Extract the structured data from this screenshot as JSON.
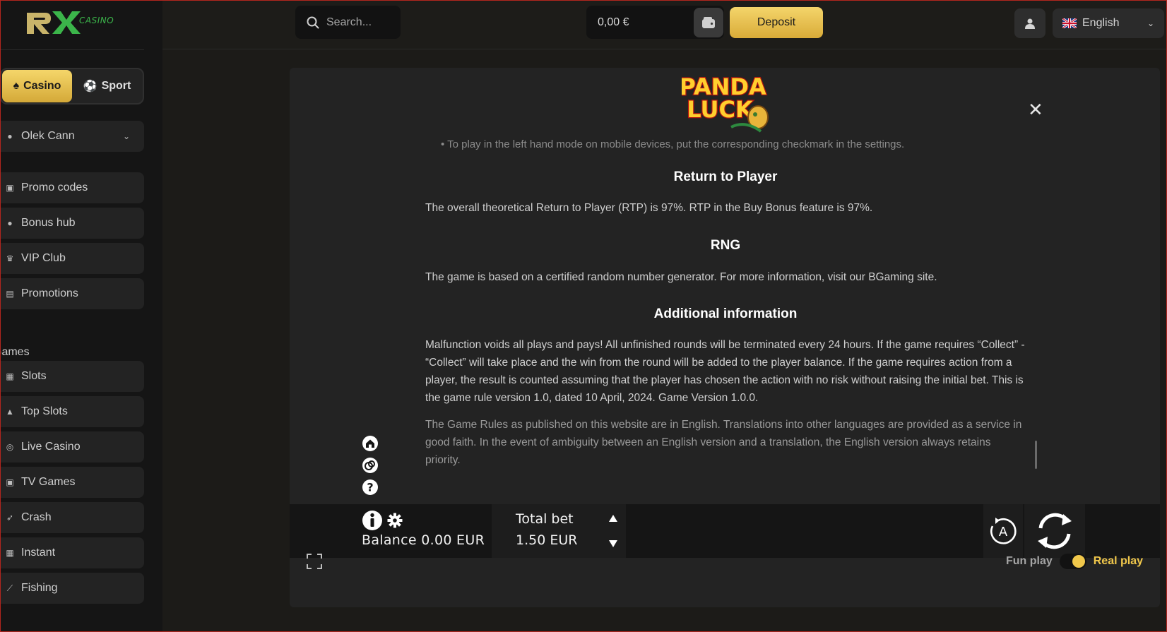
{
  "brand": {
    "logo_text": "RX",
    "logo_sub": "CASINO"
  },
  "sidebar": {
    "mode": {
      "casino_label": "Casino",
      "sport_label": "Sport",
      "active": "casino"
    },
    "user": {
      "name": "Olek Cann"
    },
    "items": [
      {
        "label": "Promo codes",
        "icon": "gift-icon"
      },
      {
        "label": "Bonus hub",
        "icon": "coin-icon"
      },
      {
        "label": "VIP Club",
        "icon": "crown-icon"
      },
      {
        "label": "Promotions",
        "icon": "percent-icon"
      }
    ],
    "games_heading": "Games",
    "games": [
      {
        "label": "Slots",
        "icon": "slot-machine-icon"
      },
      {
        "label": "Top Slots",
        "icon": "top-slots-icon"
      },
      {
        "label": "Live Casino",
        "icon": "chip-icon"
      },
      {
        "label": "TV Games",
        "icon": "tv-icon"
      },
      {
        "label": "Crash",
        "icon": "rocket-icon"
      },
      {
        "label": "Instant",
        "icon": "grid-icon"
      },
      {
        "label": "Fishing",
        "icon": "fishing-rod-icon"
      }
    ]
  },
  "header": {
    "search_placeholder": "Search...",
    "balance": "0,00 €",
    "deposit_label": "Deposit",
    "language": "English"
  },
  "game": {
    "logo_line1": "PANDA",
    "logo_line2": "LUCK",
    "rules": {
      "bullet": "To play in the left hand mode on mobile devices, put the corresponding checkmark in the settings.",
      "rtp_title": "Return to Player",
      "rtp_text": "The overall theoretical Return to Player (RTP) is 97%. RTP in the Buy Bonus feature is 97%.",
      "rng_title": "RNG",
      "rng_text": "The game is based on a certified random number generator. For more information, visit our BGaming site.",
      "additional_title": "Additional information",
      "additional_text": "Malfunction voids all plays and pays! All unfinished rounds will be terminated every 24 hours. If the game requires “Collect” - “Collect” will take place and the win from the round will be added to the player balance. If the game requires action from a player, the result is counted assuming that the player has chosen the action with no risk without raising the initial bet. This is the game rule version 1.0, dated 10 April, 2024. Game Version 1.0.0.",
      "language_text": "The Game Rules as published on this website are in English. Translations into other languages are provided as a service in good faith. In the event of ambiguity between an English version and a translation, the English version always retains priority."
    },
    "controls": {
      "balance_label": "Balance 0.00 EUR",
      "total_bet_label": "Total bet",
      "total_bet_value": "1.50 EUR",
      "auto_label": "A"
    },
    "play_mode": {
      "fun_label": "Fun play",
      "real_label": "Real play",
      "active": "real"
    }
  },
  "colors": {
    "accent": "#f1c84b",
    "logo_green": "#3bb54a",
    "frame": "#b3261e"
  }
}
